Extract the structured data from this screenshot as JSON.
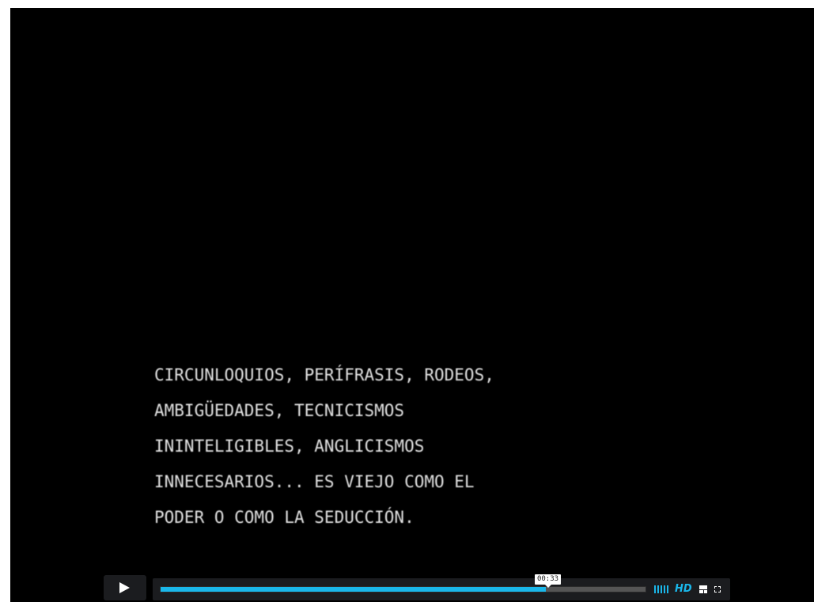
{
  "subtitle": {
    "lines": [
      "CIRCUNLOQUIOS, PERÍFRASIS, RODEOS,",
      "AMBIGÜEDADES, TECNICISMOS",
      "ININTELIGIBLES, ANGLICISMOS",
      "INNECESARIOS... ES VIEJO COMO EL",
      "PODER O COMO LA SEDUCCIÓN."
    ]
  },
  "controls": {
    "play_icon": "play-icon",
    "current_time": "00:33",
    "progress_fraction": 0.795,
    "volume_icon": "volume-bars-icon",
    "hd_label": "HD",
    "popout_icon": "popout-icon",
    "fullscreen_icon": "fullscreen-icon"
  },
  "colors": {
    "background": "#000000",
    "accent": "#1ab7ea",
    "control_bg": "#1b1c1f",
    "track": "#555555",
    "subtitle_text": "#e2e2e2"
  }
}
